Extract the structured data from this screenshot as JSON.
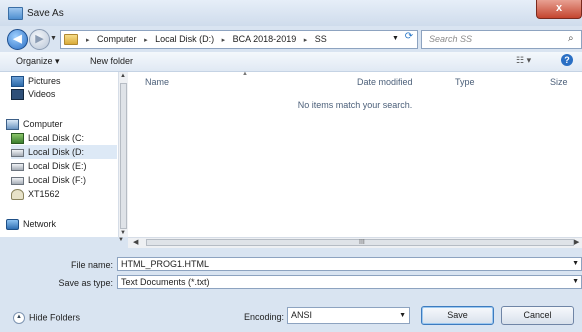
{
  "window": {
    "title": "Save As",
    "close_label": "x"
  },
  "navigation": {
    "back_glyph": "◀",
    "forward_glyph": "▶",
    "breadcrumb": [
      "Computer",
      "Local Disk (D:)",
      "BCA 2018-2019",
      "SS"
    ],
    "breadcrumb_separator": "▸",
    "search_placeholder": "Search SS"
  },
  "toolbar": {
    "organize_label": "Organize ▾",
    "new_folder_label": "New folder",
    "views_glyph": "☷ ▾",
    "help_glyph": "?"
  },
  "sidebar": {
    "items": [
      {
        "label": "Pictures",
        "icon": "pictures-icon"
      },
      {
        "label": "Videos",
        "icon": "videos-icon"
      },
      {
        "label": "Computer",
        "icon": "computer-icon"
      },
      {
        "label": "Local Disk (C:",
        "icon": "os-disk-icon"
      },
      {
        "label": "Local Disk (D:",
        "icon": "disk-icon"
      },
      {
        "label": "Local Disk (E:)",
        "icon": "disk-icon"
      },
      {
        "label": "Local Disk (F:)",
        "icon": "disk-icon"
      },
      {
        "label": "XT1562",
        "icon": "device-icon"
      },
      {
        "label": "Network",
        "icon": "network-icon"
      }
    ]
  },
  "file_list": {
    "columns": [
      "Name",
      "Date modified",
      "Type",
      "Size"
    ],
    "empty_message": "No items match your search."
  },
  "form": {
    "file_name_label": "File name:",
    "file_name_value": "HTML_PROG1.HTML",
    "save_as_type_label": "Save as type:",
    "save_as_type_value": "Text Documents (*.txt)",
    "encoding_label": "Encoding:",
    "encoding_value": "ANSI"
  },
  "footer": {
    "hide_folders_label": "Hide Folders",
    "save_label": "Save",
    "cancel_label": "Cancel"
  },
  "scroll": {
    "grip_glyph": "III"
  }
}
